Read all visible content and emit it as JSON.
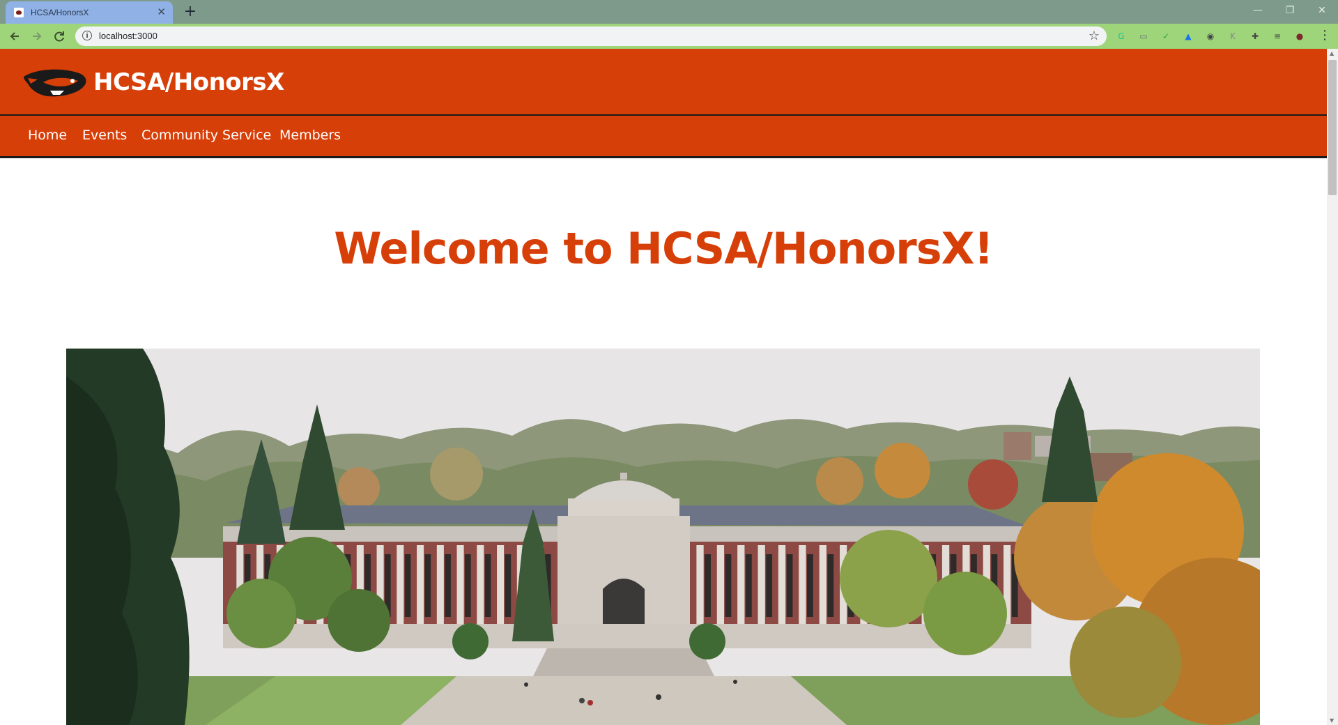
{
  "browser": {
    "tab_title": "HCSA/HonorsX",
    "tab_close": "✕",
    "new_tab": "+",
    "url": "localhost:3000",
    "window": {
      "minimize": "—",
      "maximize": "❐",
      "close": "✕"
    },
    "icons": [
      "back-icon",
      "forward-icon",
      "reload-icon",
      "info-icon",
      "star-icon",
      "menu-icon"
    ],
    "extensions": [
      {
        "name": "grammarly-extension-icon",
        "glyph": "G",
        "color": "#15c39a"
      },
      {
        "name": "extension-icon-2",
        "glyph": "▭",
        "color": "#6a6a6a"
      },
      {
        "name": "shield-extension-icon",
        "glyph": "✓",
        "color": "#2ea043"
      },
      {
        "name": "drive-extension-icon",
        "glyph": "▲",
        "color": "#1a73e8"
      },
      {
        "name": "extension-icon-5",
        "glyph": "◉",
        "color": "#444444"
      },
      {
        "name": "extension-icon-6",
        "glyph": "K",
        "color": "#888888"
      },
      {
        "name": "extensions-puzzle-icon",
        "glyph": "✚",
        "color": "#444444"
      },
      {
        "name": "reading-list-icon",
        "glyph": "≡",
        "color": "#444444"
      },
      {
        "name": "profile-avatar-icon",
        "glyph": "●",
        "color": "#7a2b2b"
      }
    ]
  },
  "site": {
    "brand_color": "#d73f09",
    "title": "HCSA/HonorsX",
    "logo": "beaver-logo-icon",
    "nav": {
      "home": "Home",
      "events": "Events",
      "service": "Community Service",
      "members": "Members"
    },
    "welcome": "Welcome to HCSA/HonorsX!",
    "hero_image": "campus-building-photo"
  }
}
